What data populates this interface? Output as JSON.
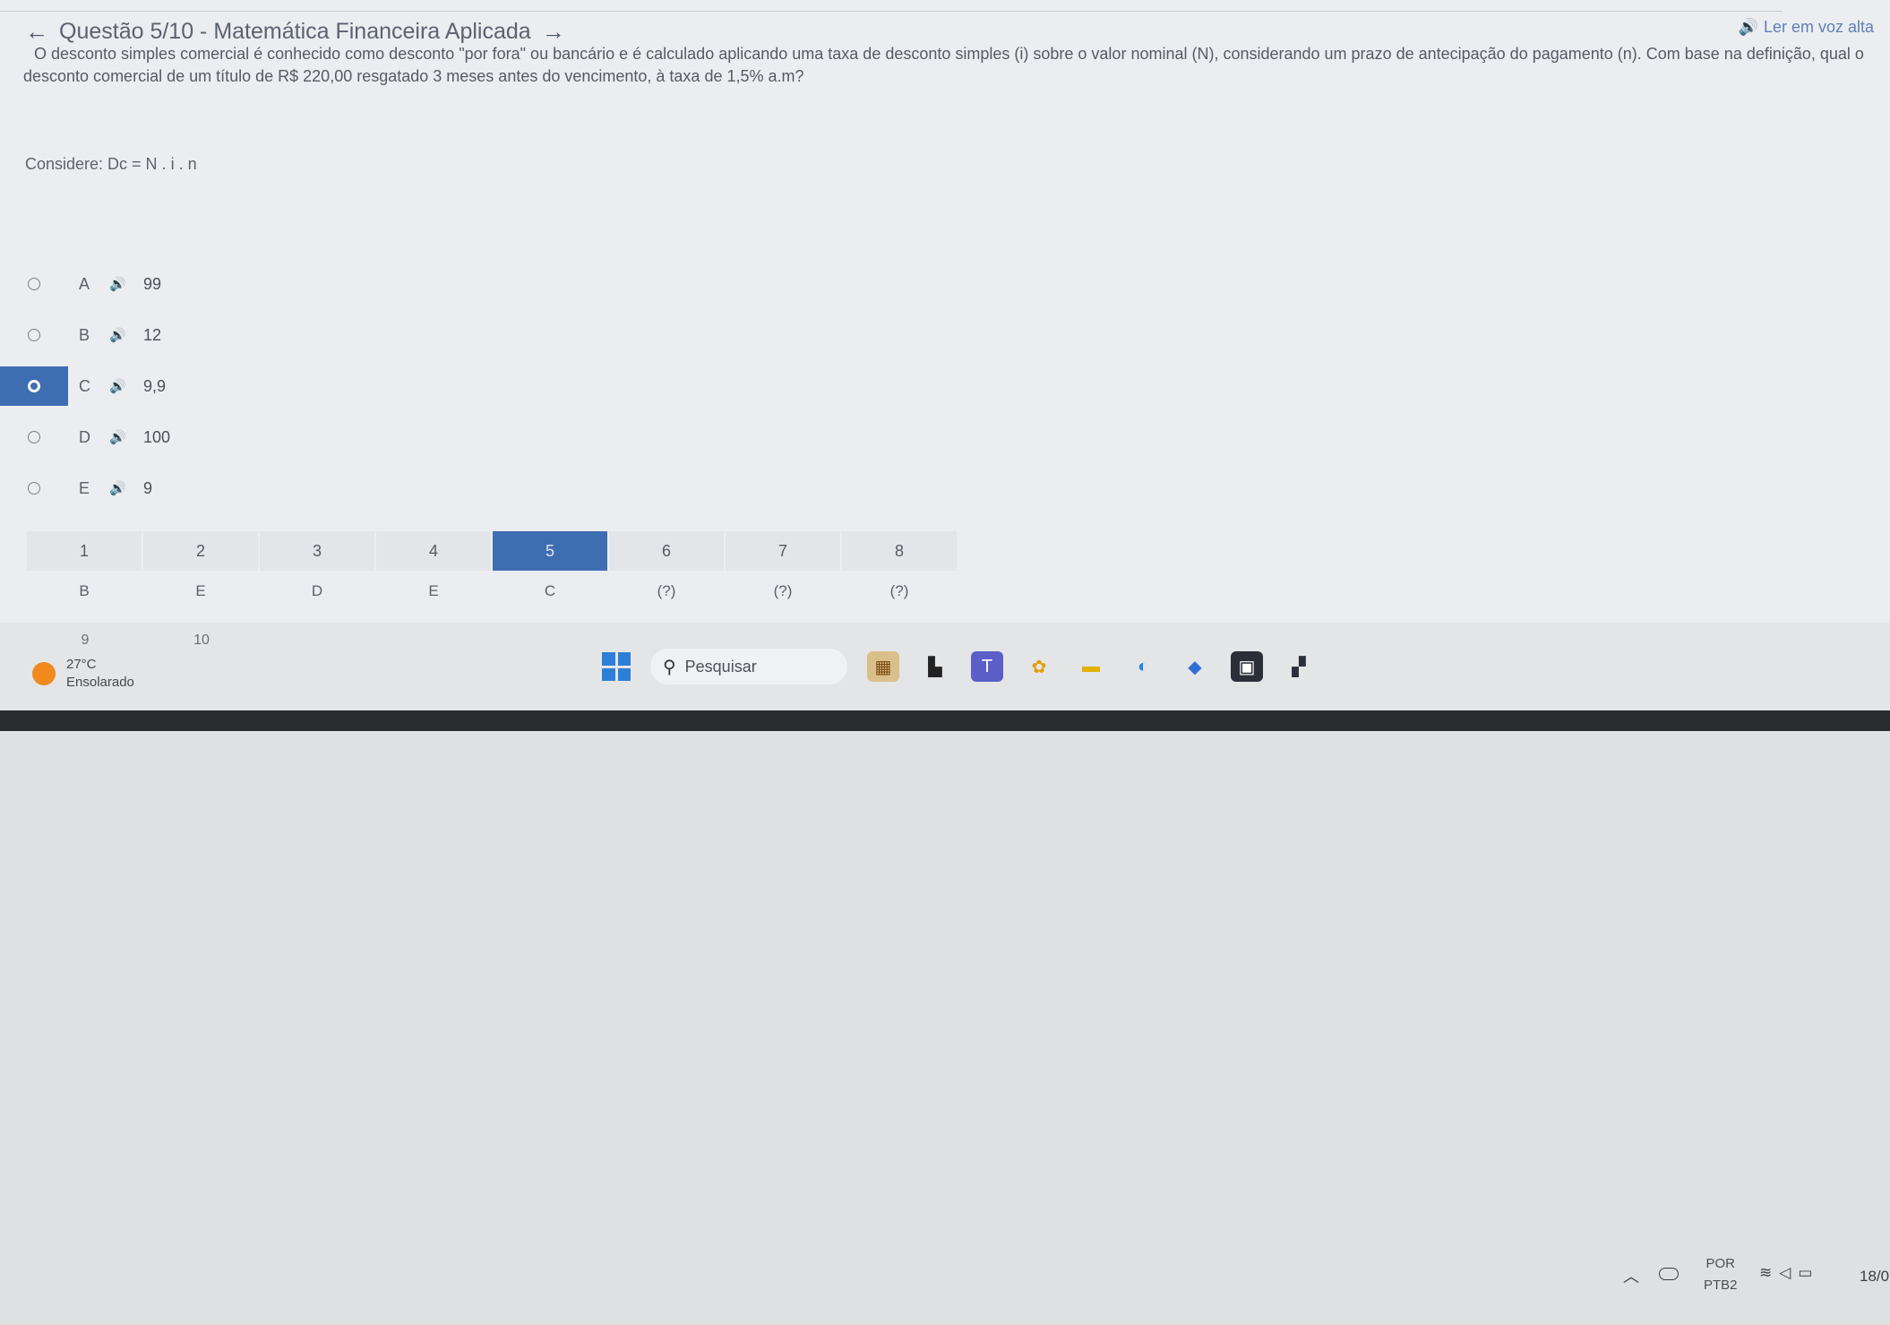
{
  "question": {
    "back_arrow": "←",
    "title": "Questão 5/10 - Matemática Financeira Aplicada",
    "next_arrow": "→",
    "read_aloud_icon": "speaker-icon",
    "read_aloud_label": "Ler em voz alta",
    "statement": "O desconto simples comercial é conhecido como desconto \"por fora\" ou bancário e é calculado aplicando uma taxa de desconto simples (i) sobre o valor nominal (N), considerando um prazo de antecipação do pagamento (n). Com base na definição, qual o desconto comercial de um título de R$ 220,00 resgatado 3 meses antes do vencimento, à taxa de 1,5% a.m?",
    "consider": "Considere: Dc = N . i . n"
  },
  "options": [
    {
      "letter": "A",
      "value": "99",
      "selected": false
    },
    {
      "letter": "B",
      "value": "12",
      "selected": false
    },
    {
      "letter": "C",
      "value": "9,9",
      "selected": true
    },
    {
      "letter": "D",
      "value": "100",
      "selected": false
    },
    {
      "letter": "E",
      "value": "9",
      "selected": false
    }
  ],
  "navigation": {
    "current": 5,
    "numbers": [
      "1",
      "2",
      "3",
      "4",
      "5",
      "6",
      "7",
      "8"
    ],
    "answers": [
      "B",
      "E",
      "D",
      "E",
      "C",
      "(?)",
      "(?)",
      "(?)"
    ],
    "next_row": [
      "9",
      "10"
    ]
  },
  "taskbar": {
    "weather_temp": "27°C",
    "weather_desc": "Ensolarado",
    "search_placeholder": "Pesquisar",
    "lang_top": "POR",
    "lang_bottom": "PTB2",
    "date_partial": "18/0"
  },
  "colors": {
    "accent": "#3f6db1",
    "screen_bg": "#ebedf0",
    "read_aloud": "#5f7fb8"
  }
}
